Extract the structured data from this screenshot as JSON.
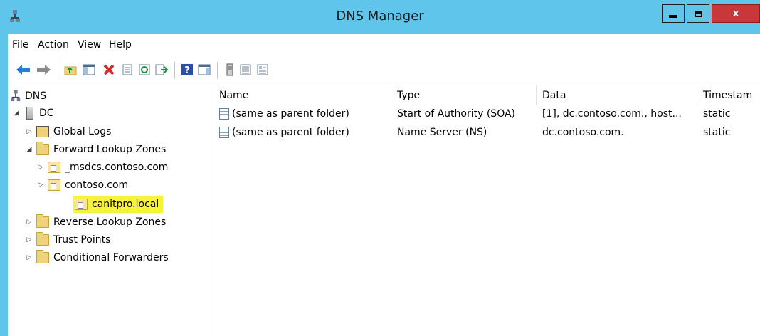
{
  "window": {
    "title": "DNS Manager",
    "buttons": {
      "minimize": "minimize",
      "maximize": "maximize",
      "close": "x"
    }
  },
  "menu": {
    "items": [
      "File",
      "Action",
      "View",
      "Help"
    ]
  },
  "toolbar": {
    "icons": [
      "back-arrow-icon",
      "forward-arrow-icon",
      "up-folder-icon",
      "show-hide-console-tree-icon",
      "delete-icon",
      "properties-icon",
      "refresh-icon",
      "export-list-icon",
      "help-icon",
      "show-action-pane-icon",
      "server-icon",
      "list-view-icon",
      "detail-view-icon"
    ]
  },
  "tree": {
    "root": "DNS",
    "server": "DC",
    "global_logs": "Global Logs",
    "forward_zones": "Forward Lookup Zones",
    "msdcs": "_msdcs.contoso.com",
    "contoso": "contoso.com",
    "canitpro": "canitpro.local",
    "reverse_zones": "Reverse Lookup Zones",
    "trust_points": "Trust Points",
    "conditional_forwarders": "Conditional Forwarders"
  },
  "list": {
    "columns": [
      "Name",
      "Type",
      "Data",
      "Timestam"
    ],
    "rows": [
      {
        "name": "(same as parent folder)",
        "type": "Start of Authority (SOA)",
        "data": "[1], dc.contoso.com., host...",
        "timestamp": "static"
      },
      {
        "name": "(same as parent folder)",
        "type": "Name Server (NS)",
        "data": "dc.contoso.com.",
        "timestamp": "static"
      }
    ]
  },
  "colors": {
    "titlebar": "#60c5ea",
    "close_button": "#c8373a",
    "selection_highlight": "#f7f33a"
  }
}
